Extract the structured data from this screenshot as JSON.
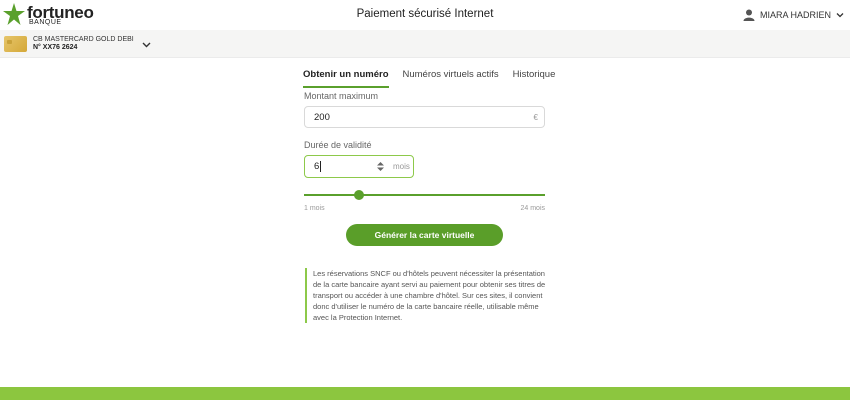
{
  "brand": {
    "name": "fortuneo",
    "sub": "BANQUE",
    "accent": "#5aa02c",
    "footer_color": "#8cc63f"
  },
  "header": {
    "title": "Paiement sécurisé Internet",
    "user": "MIARA HADRIEN"
  },
  "card": {
    "name": "CB MASTERCARD GOLD DEBI",
    "number": "N° XX76 2624"
  },
  "tabs": [
    {
      "label": "Obtenir un numéro",
      "active": true
    },
    {
      "label": "Numéros virtuels actifs",
      "active": false
    },
    {
      "label": "Historique",
      "active": false
    }
  ],
  "form": {
    "amount_label": "Montant maximum",
    "amount_value": "200",
    "amount_unit": "€",
    "duration_label": "Durée de validité",
    "duration_value": "6",
    "duration_unit": "mois",
    "slider": {
      "min_label": "1 mois",
      "max_label": "24 mois",
      "min": 1,
      "max": 24,
      "value": 6
    },
    "submit_label": "Générer la carte virtuelle"
  },
  "info_text": "Les réservations SNCF ou d'hôtels peuvent nécessiter la présentation de la carte bancaire ayant servi au paiement pour obtenir ses titres de transport ou accéder à une chambre d'hôtel. Sur ces sites, il convient donc d'utiliser le numéro de la carte bancaire réelle, utilisable même avec la Protection Internet."
}
